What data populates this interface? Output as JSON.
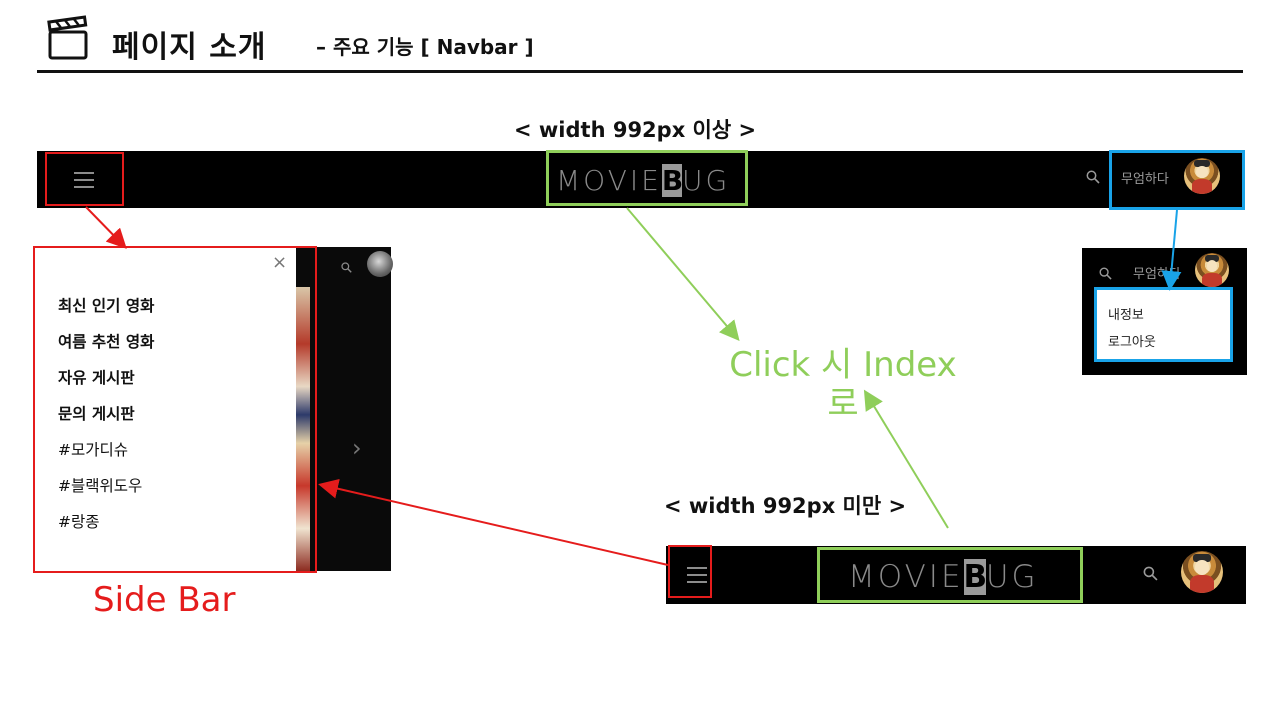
{
  "header": {
    "title": "페이지 소개",
    "subtitle": "– 주요 기능 [ Navbar ]",
    "icon": "clapperboard-icon"
  },
  "captions": {
    "large_screen": "< width 992px 이상 >",
    "small_screen": "< width 992px 미만 >",
    "sidebar": "Side Bar",
    "logo_click": "Click 시 Index 로"
  },
  "navbar": {
    "logo_prefix": "MOVIE",
    "logo_block": "B",
    "logo_suffix": "UG",
    "user_name": "무엄하다"
  },
  "sidebar": {
    "close_symbol": "×",
    "chevron": "›",
    "items": [
      {
        "label": "최신 인기 영화",
        "bold": true
      },
      {
        "label": "여름 추천 영화",
        "bold": true
      },
      {
        "label": "자유 게시판",
        "bold": true
      },
      {
        "label": "문의 게시판",
        "bold": true
      },
      {
        "label": "#모가디슈",
        "bold": false
      },
      {
        "label": "#블랙위도우",
        "bold": false
      },
      {
        "label": "#랑종",
        "bold": false
      }
    ]
  },
  "user_dropdown": {
    "user_name": "무엄하다",
    "items": [
      "내정보",
      "로그아웃"
    ]
  },
  "colors": {
    "highlight_red": "#e51c1c",
    "highlight_green": "#8fce5a",
    "highlight_blue": "#19a3e8",
    "navbar_bg": "#000000"
  }
}
